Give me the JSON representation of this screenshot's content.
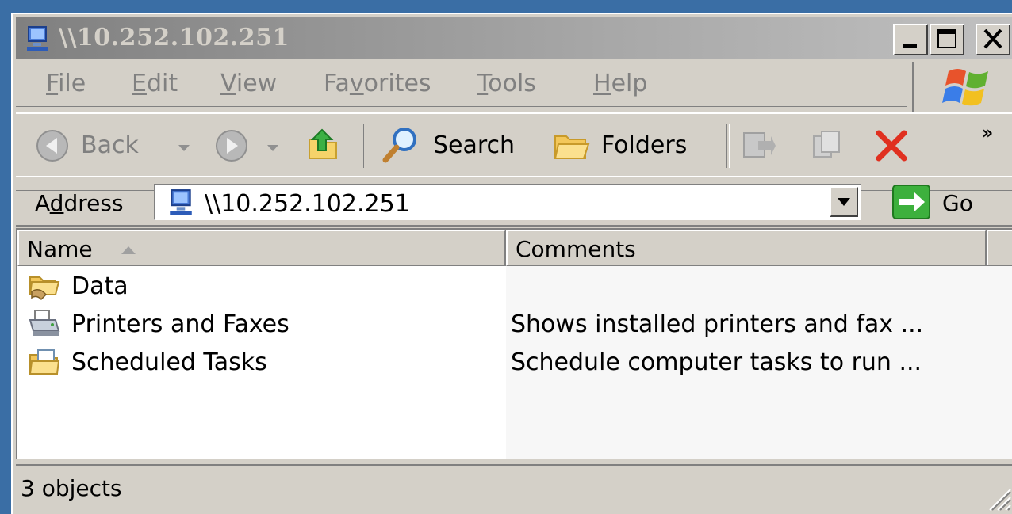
{
  "window": {
    "title": "\\\\10.252.102.251"
  },
  "menu": [
    {
      "label": "File",
      "accel": "F",
      "rest": "ile"
    },
    {
      "label": "Edit",
      "accel": "E",
      "rest": "dit"
    },
    {
      "label": "View",
      "accel": "V",
      "rest": "iew"
    },
    {
      "label": "Favorites",
      "pre": "Fa",
      "accel": "v",
      "rest": "orites"
    },
    {
      "label": "Tools",
      "accel": "T",
      "rest": "ools"
    },
    {
      "label": "Help",
      "accel": "H",
      "rest": "elp"
    }
  ],
  "toolbar": {
    "back_label": "Back",
    "search_label": "Search",
    "folders_label": "Folders",
    "more_label": "»"
  },
  "address": {
    "label_pre": "A",
    "label_accel": "d",
    "label_rest": "dress",
    "value": "\\\\10.252.102.251",
    "go_label": "Go"
  },
  "list": {
    "columns": [
      "Name",
      "Comments"
    ],
    "rows": [
      {
        "name": "Data",
        "comment": "",
        "icon": "shared-folder-icon"
      },
      {
        "name": "Printers and Faxes",
        "comment": "Shows installed printers and fax ...",
        "icon": "printer-icon"
      },
      {
        "name": "Scheduled Tasks",
        "comment": "Schedule computer tasks to run ...",
        "icon": "scheduled-tasks-icon"
      }
    ]
  },
  "status": {
    "text": "3 objects"
  },
  "colors": {
    "desktop": "#3a6ea5",
    "chrome": "#d4d0c8",
    "inactive_title": "#808080",
    "delete_red": "#e03020"
  }
}
